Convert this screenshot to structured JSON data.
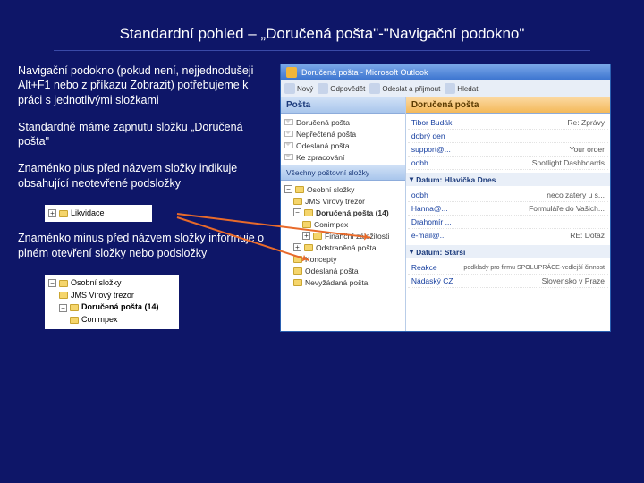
{
  "title": "Standardní pohled – „Doručená pošta\"-\"Navigační podokno\"",
  "paragraphs": {
    "p1": "Navigační podokno (pokud není, nejjednodušeji Alt+F1 nebo z příkazu Zobrazit) potřebujeme k práci s jednotlivými složkami",
    "p2": "Standardně máme zapnutu složku „Doručená pošta\"",
    "p3": "Znaménko plus před názvem složky indikuje obsahující neotevřené podsložky",
    "p4": "Znaménko minus před názvem složky informuje o plném otevření složky nebo podsložky"
  },
  "inset1": {
    "plus": "+",
    "folder": "Likvidace"
  },
  "inset2": {
    "minus": "−",
    "root": "Osobní složky",
    "sub1": "JMS Virový trezor",
    "sub2": "Doručená pošta (14)",
    "sub3": "Conimpex"
  },
  "outlook": {
    "title": "Doručená pošta - Microsoft Outlook",
    "toolbar": [
      "Nový",
      "Odpovědět",
      "Odeslat a přijmout",
      "Hledat"
    ],
    "nav_header": "Pošta",
    "inbox_header": "Doručená pošta",
    "favorites": [
      "Doručená pošta",
      "Nepřečtená pošta",
      "Odeslaná pošta",
      "Ke zpracování"
    ],
    "all_folders_label": "Všechny poštovní složky",
    "tree": {
      "root": "Osobní složky",
      "items": [
        "JMS Virový trezor",
        "Doručená pošta (14)",
        "Conimpex",
        "Finanční záležitosti",
        "Odstraněná pošta",
        "Koncepty",
        "Odeslaná pošta",
        "Nevyžádaná pošta"
      ]
    },
    "group_today": "Datum: Hlavička Dnes",
    "group_older": "Datum: Starší",
    "messages": [
      {
        "from": "Tibor Budák",
        "subj": "Re: Zprávy"
      },
      {
        "from": "dobrý den",
        "subj": ""
      },
      {
        "from": "support@...",
        "subj": "Your order"
      },
      {
        "from": "oobh",
        "subj": "Spotlight Dashboards"
      },
      {
        "from": "oobh",
        "subj": "neco zatery u s..."
      },
      {
        "from": "Hanna@...",
        "subj": "Formuláře do Vašich..."
      },
      {
        "from": "Drahomír ...",
        "subj": ""
      },
      {
        "from": "e-mail@...",
        "subj": "RE: Dotaz"
      },
      {
        "from": "Reakce",
        "subj": "podklady pro firmu SPOLUPRÁCE-vedlejší činnost"
      },
      {
        "from": "Nádaský CZ",
        "subj": "Slovensko v Praze"
      }
    ]
  }
}
